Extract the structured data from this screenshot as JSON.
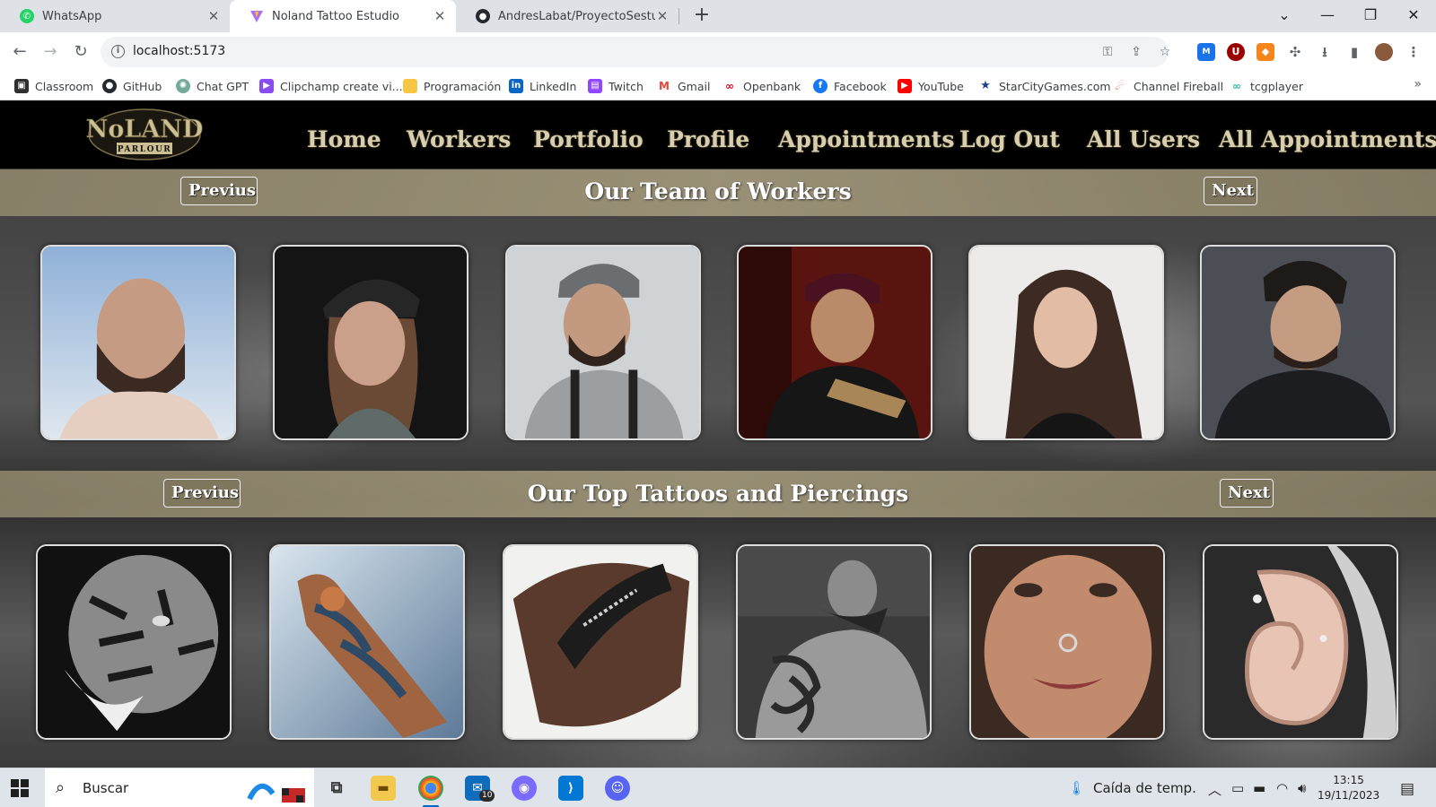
{
  "browser": {
    "tabs": [
      {
        "title": "WhatsApp",
        "icon": "whatsapp-icon",
        "color": "#25d366"
      },
      {
        "title": "Noland Tattoo Estudio",
        "icon": "vite-icon",
        "color": "#a96df7"
      },
      {
        "title": "AndresLabat/ProyectoSestudioD",
        "icon": "github-icon",
        "color": "#24292f"
      }
    ],
    "url": "localhost:5173",
    "bookmarks": [
      {
        "label": "Classroom",
        "icon": "classroom-icon",
        "color": "#2f2f2f"
      },
      {
        "label": "GitHub",
        "icon": "github-icon",
        "color": "#24292f"
      },
      {
        "label": "Chat GPT",
        "icon": "chatgpt-icon",
        "color": "#74aa9c"
      },
      {
        "label": "Clipchamp create vi...",
        "icon": "clipchamp-icon",
        "color": "#8a4cf0"
      },
      {
        "label": "Programación",
        "icon": "folder-icon",
        "color": "#f6c744"
      },
      {
        "label": "LinkedIn",
        "icon": "linkedin-icon",
        "color": "#0a66c2"
      },
      {
        "label": "Twitch",
        "icon": "twitch-icon",
        "color": "#9146ff"
      },
      {
        "label": "Gmail",
        "icon": "gmail-icon",
        "color": "#ea4335"
      },
      {
        "label": "Openbank",
        "icon": "openbank-icon",
        "color": "#e3001b"
      },
      {
        "label": "Facebook",
        "icon": "facebook-icon",
        "color": "#1877f2"
      },
      {
        "label": "YouTube",
        "icon": "youtube-icon",
        "color": "#ff0000"
      },
      {
        "label": "StarCityGames.com",
        "icon": "star-icon",
        "color": "#1d3f8f"
      },
      {
        "label": "Channel Fireball",
        "icon": "fireball-icon",
        "color": "#e84a27"
      },
      {
        "label": "tcgplayer",
        "icon": "tcgplayer-icon",
        "color": "#2cb7a8"
      }
    ]
  },
  "site": {
    "logo_text": "NoLAND",
    "logo_sub": "PARLOUR",
    "nav": [
      "Home",
      "Workers",
      "Portfolio",
      "Profile",
      "Appointments",
      "Log Out",
      "All Users",
      "All Appointments"
    ],
    "workers_section": {
      "title": "Our Team of Workers",
      "prev": "Previus",
      "next": "Next"
    },
    "tattoos_section": {
      "title": "Our Top Tattoos and Piercings",
      "prev": "Previus",
      "next": "Next"
    }
  },
  "taskbar": {
    "search_placeholder": "Buscar",
    "mail_badge": "10",
    "weather": "Caída de temp.",
    "time": "13:15",
    "date": "19/11/2023"
  }
}
